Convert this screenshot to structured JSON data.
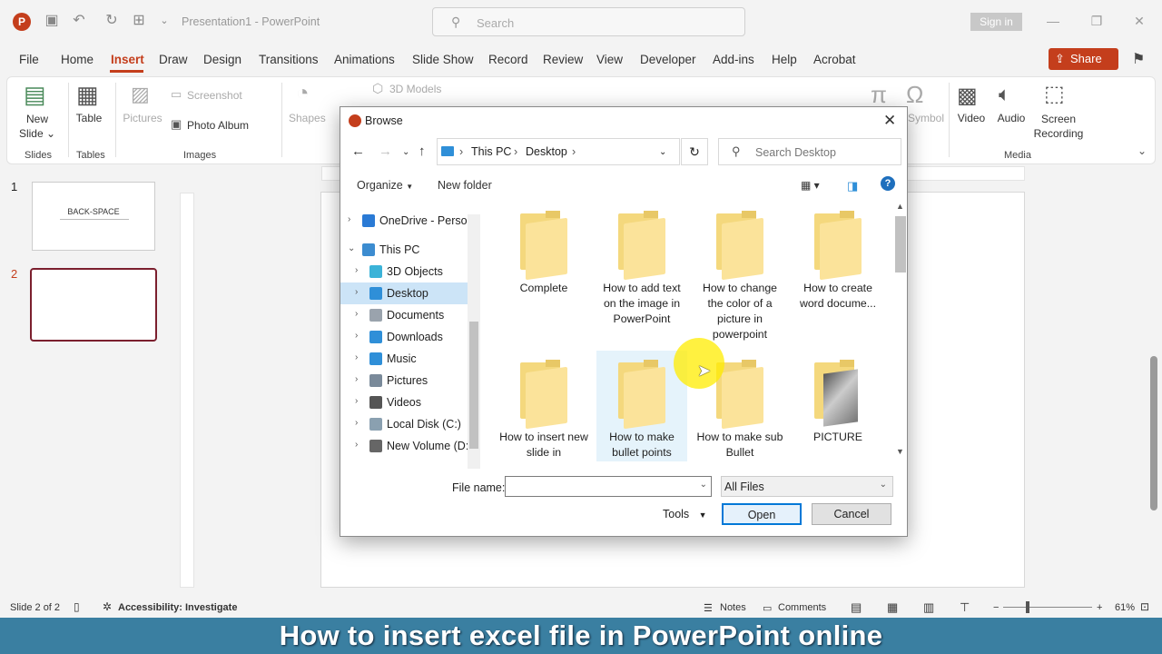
{
  "app": {
    "logo_letter": "P",
    "title": "Presentation1  -  PowerPoint",
    "search_placeholder": "Search",
    "signin": "Sign in",
    "share": "Share"
  },
  "menu": [
    "File",
    "Home",
    "Insert",
    "Draw",
    "Design",
    "Transitions",
    "Animations",
    "Slide Show",
    "Record",
    "Review",
    "View",
    "Developer",
    "Add-ins",
    "Help",
    "Acrobat"
  ],
  "menu_active": "Insert",
  "ribbon": {
    "new_slide": [
      "New",
      "Slide ⌄"
    ],
    "table": "Table",
    "pictures": "Pictures",
    "screenshot": "Screenshot",
    "photo_album": "Photo Album",
    "shapes": "Shapes",
    "models": "3D Models",
    "symbol": "Symbol",
    "video": "Video",
    "audio": "Audio",
    "screen_recording": [
      "Screen",
      "Recording"
    ],
    "groups": {
      "slides": "Slides",
      "tables": "Tables",
      "images": "Images",
      "media": "Media"
    }
  },
  "slides_panel": {
    "numbers": [
      "1",
      "2"
    ],
    "thumb1_title": "BACK-SPACE"
  },
  "dialog": {
    "title": "Browse",
    "path": [
      "This PC",
      "Desktop"
    ],
    "search_placeholder": "Search Desktop",
    "organize": "Organize",
    "new_folder": "New folder",
    "nav": [
      {
        "label": "OneDrive - Person",
        "icon": "onedrive-icon",
        "color": "#2a7ad5",
        "indent": 0,
        "chev": ">",
        "selected": false
      },
      {
        "label": "This PC",
        "icon": "pc-icon",
        "color": "#3c8cd0",
        "indent": 0,
        "chev": "v",
        "selected": false
      },
      {
        "label": "3D Objects",
        "icon": "cube-icon",
        "color": "#3bb3d8",
        "indent": 1,
        "chev": ">",
        "selected": false
      },
      {
        "label": "Desktop",
        "icon": "desktop-icon",
        "color": "#2f8fd8",
        "indent": 1,
        "chev": ">",
        "selected": true
      },
      {
        "label": "Documents",
        "icon": "document-icon",
        "color": "#9aa3ad",
        "indent": 1,
        "chev": ">",
        "selected": false
      },
      {
        "label": "Downloads",
        "icon": "download-icon",
        "color": "#2f8fd8",
        "indent": 1,
        "chev": ">",
        "selected": false
      },
      {
        "label": "Music",
        "icon": "music-icon",
        "color": "#2f8fd8",
        "indent": 1,
        "chev": ">",
        "selected": false
      },
      {
        "label": "Pictures",
        "icon": "pictures-icon",
        "color": "#7a8a9a",
        "indent": 1,
        "chev": ">",
        "selected": false
      },
      {
        "label": "Videos",
        "icon": "video-icon",
        "color": "#555555",
        "indent": 1,
        "chev": ">",
        "selected": false
      },
      {
        "label": "Local Disk (C:)",
        "icon": "disk-icon",
        "color": "#8aa0b0",
        "indent": 1,
        "chev": ">",
        "selected": false
      },
      {
        "label": "New Volume (D:)",
        "icon": "drive-icon",
        "color": "#666666",
        "indent": 1,
        "chev": ">",
        "selected": false
      }
    ],
    "files": [
      {
        "name": "Complete",
        "type": "folder-docs"
      },
      {
        "name": "How to add text on the image in PowerPoint",
        "type": "folder"
      },
      {
        "name": "How to change the color of a picture in powerpoint",
        "type": "folder"
      },
      {
        "name": "How to create word docume...",
        "type": "folder"
      },
      {
        "name": "How to insert new slide in",
        "type": "folder"
      },
      {
        "name": "How to make bullet points",
        "type": "folder"
      },
      {
        "name": "How to make sub Bullet",
        "type": "folder"
      },
      {
        "name": "PICTURE",
        "type": "folder-photo"
      }
    ],
    "file_name_label": "File name:",
    "file_name_value": "",
    "file_type": "All Files",
    "tools": "Tools",
    "open": "Open",
    "cancel": "Cancel"
  },
  "status": {
    "slide": "Slide 2 of 2",
    "accessibility": "Accessibility: Investigate",
    "notes": "Notes",
    "comments": "Comments",
    "zoom": "61%"
  },
  "caption": "How to insert excel file in PowerPoint online"
}
